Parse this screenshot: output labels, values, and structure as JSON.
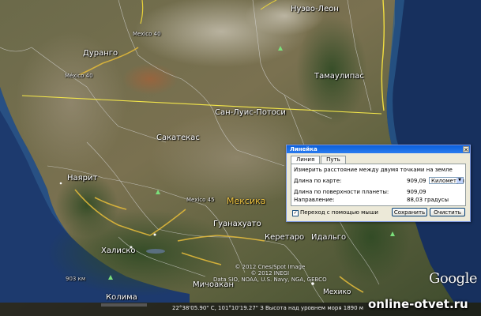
{
  "map": {
    "states": {
      "nuevo_leon": "Нуэво-Леон",
      "durango": "Дуранго",
      "tamaulipas": "Тамаулипас",
      "san_luis_potosi": "Сан-Луис-Потоси",
      "zacatecas": "Сакатекас",
      "nayarit": "Наярит",
      "guanajuato": "Гуанахуато",
      "queretaro": "Керетаро",
      "hidalgo": "Идальго",
      "jalisco": "Халиско",
      "michoacan": "Мичоакан",
      "colima": "Колима",
      "mexico_state": "Мехико"
    },
    "country": "Мексика",
    "highways": {
      "hw40a": "México 40",
      "hw40b": "Mexico 40",
      "hw45": "Mexico 45"
    },
    "scale_hint": "903 км",
    "brand": "Google",
    "copyright_lines": [
      "© 2012 Cnes/Spot Image",
      "© 2012 INEGI",
      "Data SIO, NOAA, U.S. Navy, NGA, GEBCO"
    ]
  },
  "status": {
    "text": "22°38'05.90\" С, 101°10'19.27\" З  Высота над уровнем моря  1890 м"
  },
  "watermark": "online-otvet.ru",
  "ruler": {
    "title": "Линейка",
    "close_glyph": "✕",
    "tabs": [
      "Линия",
      "Путь"
    ],
    "instruction": "Измерить расстояние между двумя точками на земле",
    "map_length_label": "Длина по карте:",
    "map_length_value": "909,09",
    "unit": "Километры",
    "ground_length_label": "Длина по поверхности планеты:",
    "ground_length_value": "909,09",
    "heading_label": "Направление:",
    "heading_value": "88,03 градусы",
    "mouse_nav_label": "Переход с помощью мыши",
    "mouse_nav_checked": true,
    "save_label": "Сохранить",
    "clear_label": "Очистить"
  }
}
